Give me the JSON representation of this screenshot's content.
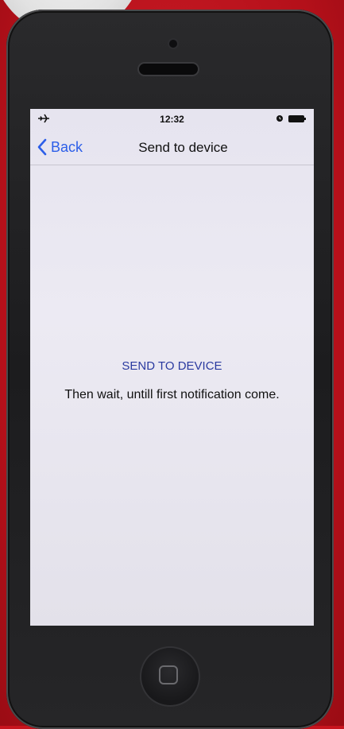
{
  "status_bar": {
    "time": "12:32",
    "left_icon": "airplane-icon",
    "right_icons": [
      "alarm-icon",
      "battery-icon"
    ]
  },
  "nav": {
    "back_label": "Back",
    "back_icon": "chevron-left-icon",
    "title": "Send to device"
  },
  "content": {
    "send_link": "SEND TO DEVICE",
    "instructions": "Then wait, untill first notification come."
  },
  "colors": {
    "accent": "#2c5ee8",
    "link": "#2a3aa0",
    "background": "#eceaf3",
    "device_body": "#1c1c1e",
    "backdrop": "#c8141e"
  }
}
